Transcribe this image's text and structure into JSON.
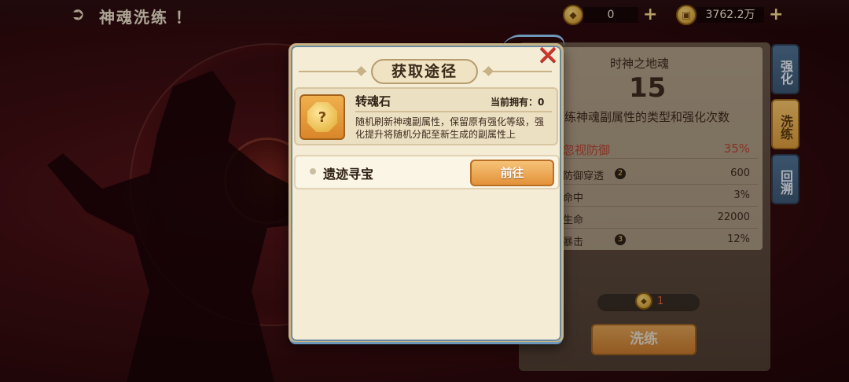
{
  "header": {
    "title": "神魂洗练 ！",
    "back_icon": "back-arrow-icon",
    "currencies": [
      {
        "icon": "coin-icon",
        "value": "0"
      },
      {
        "icon": "copper-coin-icon",
        "value": "3762.2万"
      }
    ]
  },
  "right_panel": {
    "title": "时神之地魂",
    "level": "15",
    "description": "练神魂副属性的类型和强化次数",
    "stats": [
      {
        "name": "忽视防御",
        "value": "35%",
        "highlight": true
      },
      {
        "name": "防御穿透",
        "badge": "2",
        "value": "600"
      },
      {
        "name": "命中",
        "value": "3%"
      },
      {
        "name": "生命",
        "value": "22000"
      },
      {
        "name": "暴击",
        "badge": "3",
        "value": "12%"
      }
    ],
    "cost": "1",
    "refine_button": "洗练",
    "tabs": [
      {
        "label": "强化",
        "active": false
      },
      {
        "label": "洗练",
        "active": true
      },
      {
        "label": "回溯",
        "active": false
      }
    ]
  },
  "modal": {
    "title": "获取途径",
    "close_icon": "close-x-icon",
    "item": {
      "name": "转魂石",
      "owned_label": "当前拥有：0",
      "description": "随机刷新神魂副属性，保留原有强化等级，强化提升将随机分配至新生成的副属性上"
    },
    "sources": [
      {
        "name": "遗迹寻宝",
        "button": "前往"
      }
    ]
  },
  "colors": {
    "accent": "#e3923a",
    "close": "#d2372b",
    "modal_bg": "#f5ecd6",
    "tab_active": "#f3c169",
    "tab_inactive": "#4e6f90"
  }
}
